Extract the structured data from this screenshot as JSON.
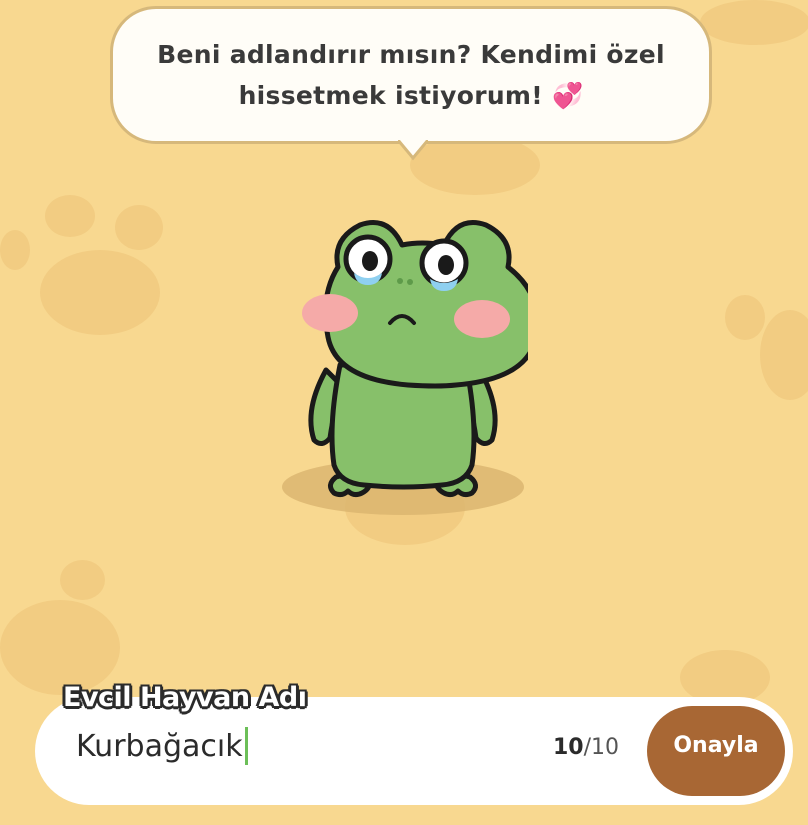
{
  "speech_bubble": {
    "text": "Beni adlandırır mısın? Kendimi özel hissetmek istiyorum! 💞"
  },
  "pet": {
    "character": "frog",
    "mood": "crying",
    "colors": {
      "body": "#87c06a",
      "outline": "#1a1a1a",
      "cheek": "#f5aaa8",
      "tear": "#8fd0f0"
    }
  },
  "name_form": {
    "label": "Evcil Hayvan Adı",
    "value": "Kurbağacık",
    "count_current": "10",
    "count_separator": "/",
    "count_max": "10",
    "confirm_label": "Onayla"
  },
  "colors": {
    "background": "#f8d890",
    "paw_print": "#f2cc82",
    "confirm_button": "#a86734",
    "caret": "#6cbf58"
  }
}
